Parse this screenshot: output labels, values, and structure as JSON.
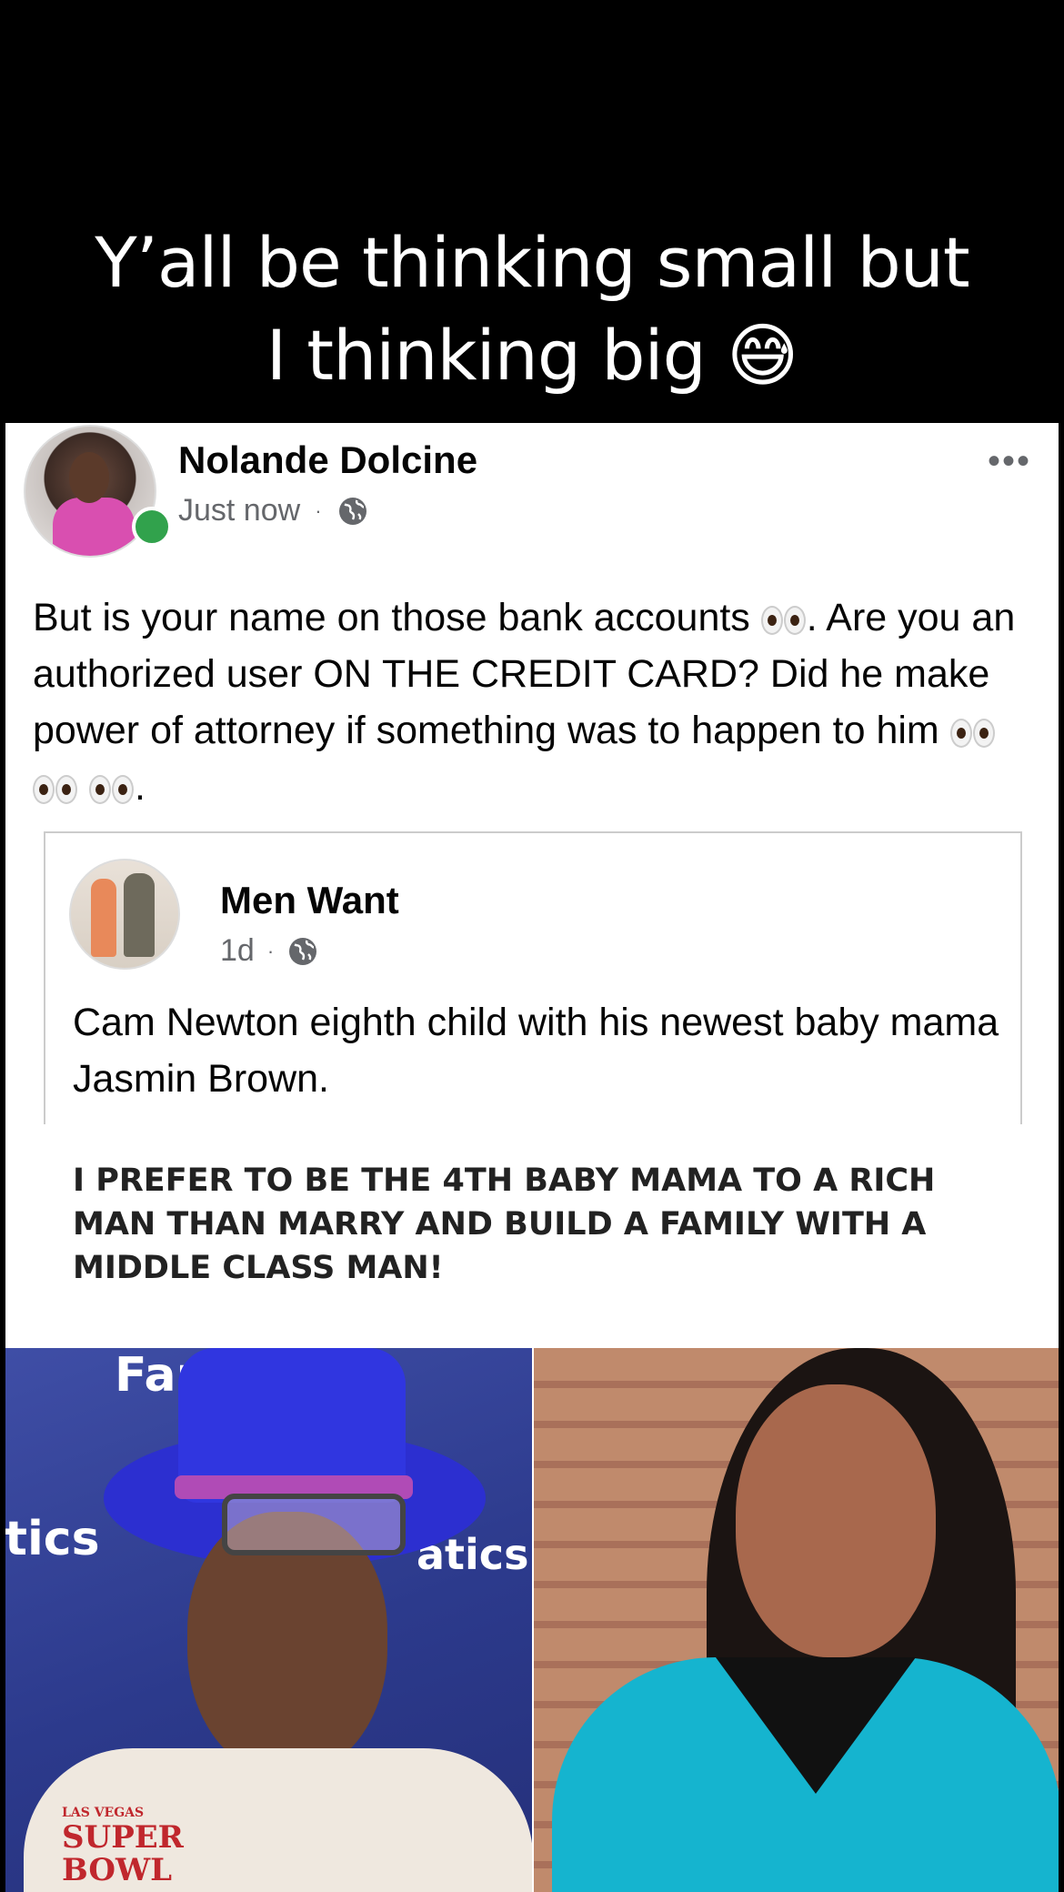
{
  "caption": {
    "line1": "Y’all be thinking small but",
    "line2": "I thinking big 😅"
  },
  "post": {
    "author": "Nolande Dolcine",
    "time": "Just now",
    "separator": "·",
    "more_menu": "•••",
    "text_1": "But is your name on those bank accounts ",
    "text_2": ". Are you an authorized user ON THE CREDIT CARD? Did he make power of attorney if something was to happen to him ",
    "text_3": ".",
    "online_color": "#31a24c"
  },
  "shared": {
    "author": "Men Want",
    "time": "1d",
    "separator": "·",
    "text": "Cam Newton eighth child with his newest baby mama Jasmin Brown.",
    "meme_text": "I PREFER TO BE THE 4TH BABY MAMA TO A RICH MAN THAN MARRY AND BUILD A FAMILY WITH A MIDDLE CLASS MAN!"
  },
  "photo": {
    "bg_word_1": "Fan",
    "bg_word_2": "atics",
    "bg_word_3": "atics",
    "jacket_small": "LAS VEGAS",
    "jacket_line1": "SUPER",
    "jacket_line2": "BOWL"
  },
  "icons": {
    "globe": "globe-icon",
    "more": "more-options-icon",
    "eyes": "eyes-emoji-icon"
  }
}
